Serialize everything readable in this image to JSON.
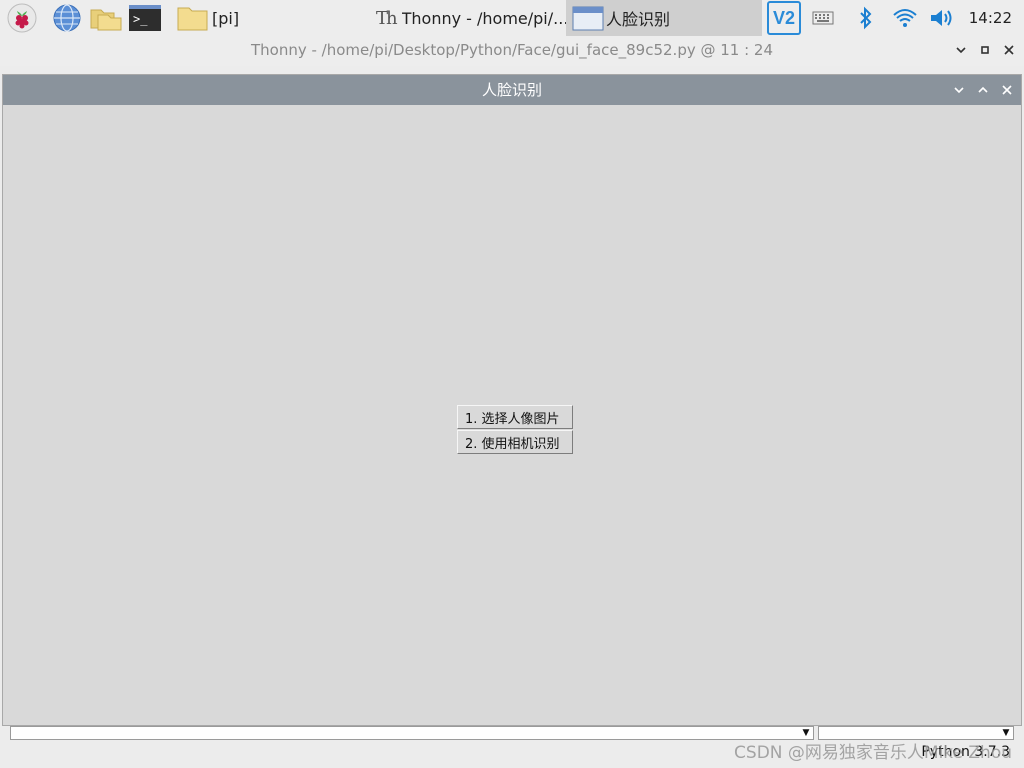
{
  "taskbar": {
    "items": [
      {
        "id": "raspberry-menu",
        "icon": "raspberry-icon"
      },
      {
        "id": "web-browser",
        "icon": "globe-icon"
      },
      {
        "id": "file-manager",
        "icon": "folder-icon"
      },
      {
        "id": "terminal",
        "icon": "terminal-icon",
        "glyph": ">_"
      }
    ],
    "tasks": [
      {
        "label": "[pi]",
        "icon": "folder-icon"
      },
      {
        "label": "Thonny  -  /home/pi/...",
        "icon": "thonny-icon",
        "glyph": "Th"
      },
      {
        "label": "人脸识别",
        "icon": "window-icon",
        "active": true
      }
    ],
    "tray": {
      "vnc_glyph": "V2",
      "clock": "14:22"
    }
  },
  "thonny_window": {
    "title": "Thonny  -  /home/pi/Desktop/Python/Face/gui_face_89c52.py  @  11 : 24",
    "controls": {
      "minimize": "⌄",
      "maximize": "▫",
      "close": "✕"
    }
  },
  "dialog": {
    "title": "人脸识别",
    "controls": {
      "minimize": "⌄",
      "maximize": "⌃",
      "close": "✕"
    },
    "buttons": [
      {
        "label": "1.   选择人像图片"
      },
      {
        "label": "2.   使用相机识别"
      }
    ]
  },
  "bottom": {
    "combo_arrow": "▼",
    "status": "Python 3.7.3",
    "watermark": "CSDN @网易独家音乐人Mike Zhou"
  },
  "colors": {
    "dialog_title_bg": "#8a939c",
    "dialog_bg": "#d9d9d9",
    "panel_bg": "#ededed",
    "active_task_bg": "#cfcfcf"
  }
}
